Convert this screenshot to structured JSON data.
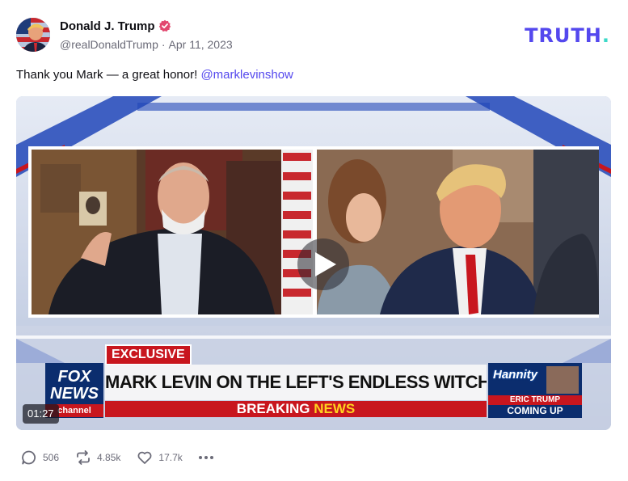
{
  "author": {
    "name": "Donald J. Trump",
    "handle": "@realDonaldTrump",
    "separator": "·",
    "date": "Apr 11, 2023",
    "verified_color": "#e2476f"
  },
  "brand": {
    "logo_main": "TRUTH",
    "logo_dot": ".",
    "accent": "#5448ee",
    "dot_color": "#3cd9c8"
  },
  "post": {
    "text": "Thank you Mark — a great honor! ",
    "mention": "@marklevinshow"
  },
  "video": {
    "duration": "01:27",
    "chyron_tag": "EXCLUSIVE",
    "headline": "MARK LEVIN ON THE LEFT'S ENDLESS WITCH HUNTS",
    "breaking_1": "BREAKING",
    "breaking_2": "NEWS",
    "network_line1": "FOX",
    "network_line2": "NEWS",
    "network_line3": "channel",
    "promo_show": "Hannity",
    "promo_guest": "ERIC TRUMP",
    "promo_status": "COMING UP"
  },
  "actions": {
    "replies": "506",
    "retruths": "4.85k",
    "likes": "17.7k"
  },
  "icons": [
    "verified-badge-icon",
    "play-icon",
    "reply-icon",
    "retruth-icon",
    "like-icon",
    "more-icon"
  ]
}
